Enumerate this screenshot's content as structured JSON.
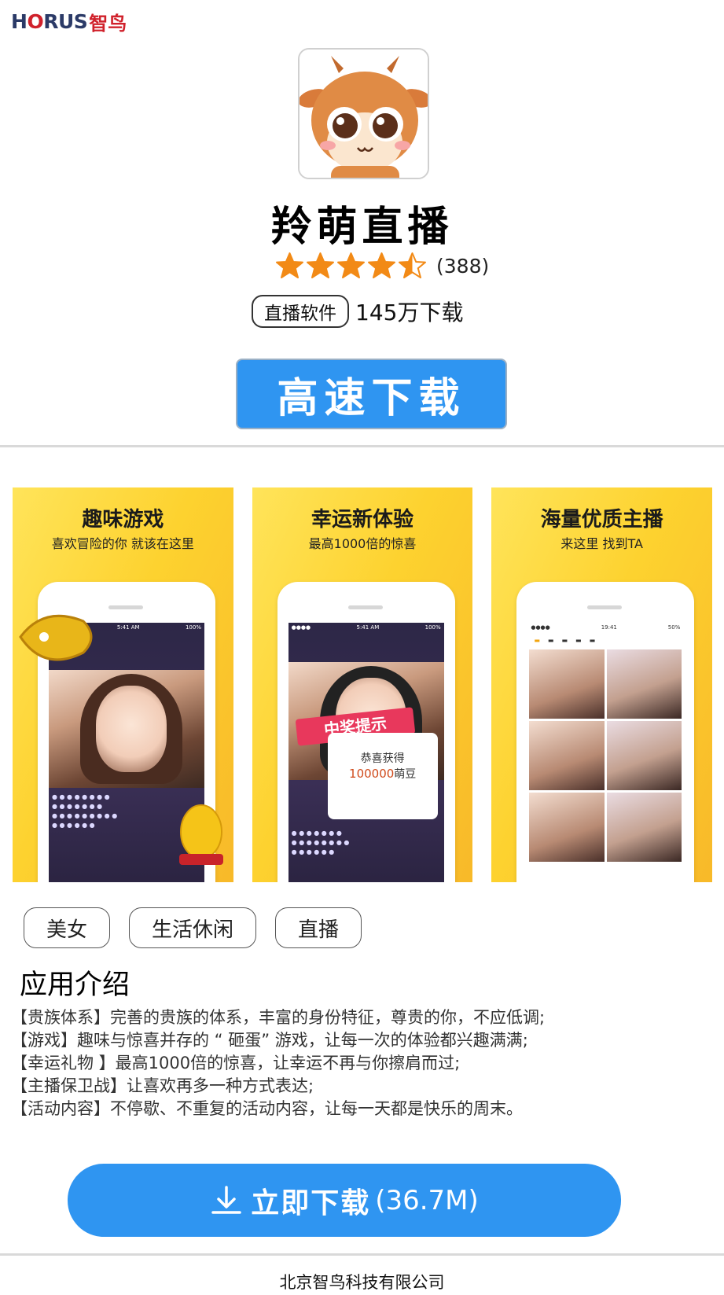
{
  "brand": {
    "logo_text_a": "H",
    "logo_text_o": "O",
    "logo_text_b": "RUS",
    "logo_cn": "智鸟"
  },
  "app": {
    "name": "羚萌直播",
    "rating_count": "(388)",
    "rating_value": 4.5,
    "category": "直播软件",
    "downloads": "145万下载",
    "top_download_label": "高速下载"
  },
  "screenshots": [
    {
      "title": "趣味游戏",
      "subtitle": "喜欢冒险的你 就该在这里"
    },
    {
      "title": "幸运新体验",
      "subtitle": "最高1000倍的惊喜",
      "banner": "中奖提示",
      "card_line1": "恭喜获得",
      "card_line2": "100000",
      "card_line3": "萌豆"
    },
    {
      "title": "海量优质主播",
      "subtitle": "来这里 找到TA"
    }
  ],
  "tags": [
    "美女",
    "生活休闲",
    "直播"
  ],
  "intro": {
    "heading": "应用介绍",
    "lines": [
      "【贵族体系】完善的贵族的体系，丰富的身份特征，尊贵的你，不应低调;",
      "【游戏】趣味与惊喜并存的 “ 砸蛋” 游戏，让每一次的体验都兴趣满满;",
      "【幸运礼物 】最高1000倍的惊喜，让幸运不再与你擦肩而过;",
      "【主播保卫战】让喜欢再多一种方式表达;",
      "【活动内容】不停歇、不重复的活动内容，让每一天都是快乐的周末。"
    ]
  },
  "bottom_button": {
    "label": "立即下载",
    "size": "(36.7M)"
  },
  "footer": {
    "company": "北京智鸟科技有限公司"
  },
  "colors": {
    "accent": "#2f95f1",
    "star": "#f28a16",
    "screenshot_bg": "#fed83c"
  }
}
